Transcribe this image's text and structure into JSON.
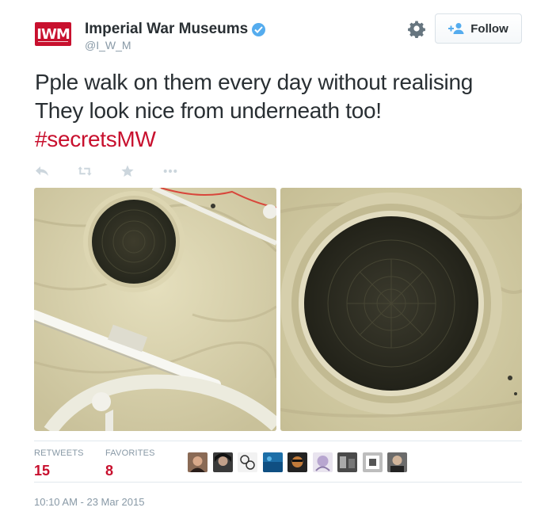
{
  "account": {
    "logo_text": "IWM",
    "display_name": "Imperial War Museums",
    "handle": "@I_W_M",
    "verified": true
  },
  "header": {
    "settings_icon": "gear-icon",
    "follow_label": "Follow"
  },
  "tweet": {
    "line1": "Pple walk on them every day without realising",
    "line2": "They look nice from underneath too!",
    "hashtag": "#secretsMW"
  },
  "actions": [
    "reply-icon",
    "retweet-icon",
    "favorite-icon",
    "more-icon"
  ],
  "stats": {
    "retweets_label": "RETWEETS",
    "retweets_value": "15",
    "favorites_label": "FAVORITES",
    "favorites_value": "8"
  },
  "avatar_count": 9,
  "timestamp": "10:10 AM - 23 Mar 2015",
  "colors": {
    "brand": "#c8102e",
    "verified": "#55acee",
    "muted": "#8899a6"
  }
}
